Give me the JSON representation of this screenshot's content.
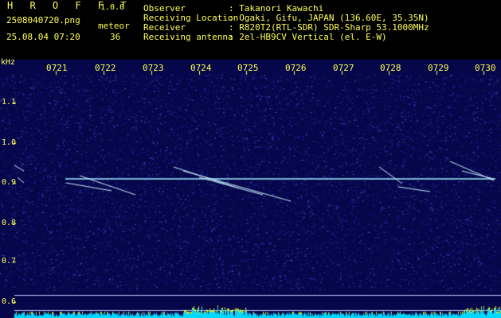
{
  "header": {
    "app_title": "H R O F F T",
    "version": "1.0.0",
    "file_name": "2508040720.png",
    "meteor_label": "meteor",
    "date_time": "25.08.04 07:20",
    "meteor_count": "36",
    "info": [
      {
        "label": "Observer",
        "value": ": Takanori Kawachi"
      },
      {
        "label": "Receiving Location",
        "value": ": Ogaki, Gifu, JAPAN (136.60E, 35.35N)"
      },
      {
        "label": "Receiver",
        "value": ": R820T2(RTL-SDR) SDR-Sharp 53.1000MHz"
      },
      {
        "label": "Receiving antenna",
        "value": ": 2el-HB9CV Vertical (el. E-W)"
      }
    ]
  },
  "plot": {
    "unit": "kHz",
    "time_ticks": [
      "0721",
      "0722",
      "0723",
      "0724",
      "0725",
      "0726",
      "0727",
      "0728",
      "0729",
      "0730"
    ],
    "freq_ticks": [
      "1.1",
      "1.0",
      "0.9",
      "0.8",
      "0.7",
      "0.6"
    ],
    "colors": {
      "background": "#06064a",
      "noise": "#2a35b0",
      "carrier": "#9fe8ff",
      "meteor": "#c8f0ff",
      "power_fill": "#00d8ff",
      "power_peak": "#ffee00",
      "text": "#ffff55"
    }
  }
}
